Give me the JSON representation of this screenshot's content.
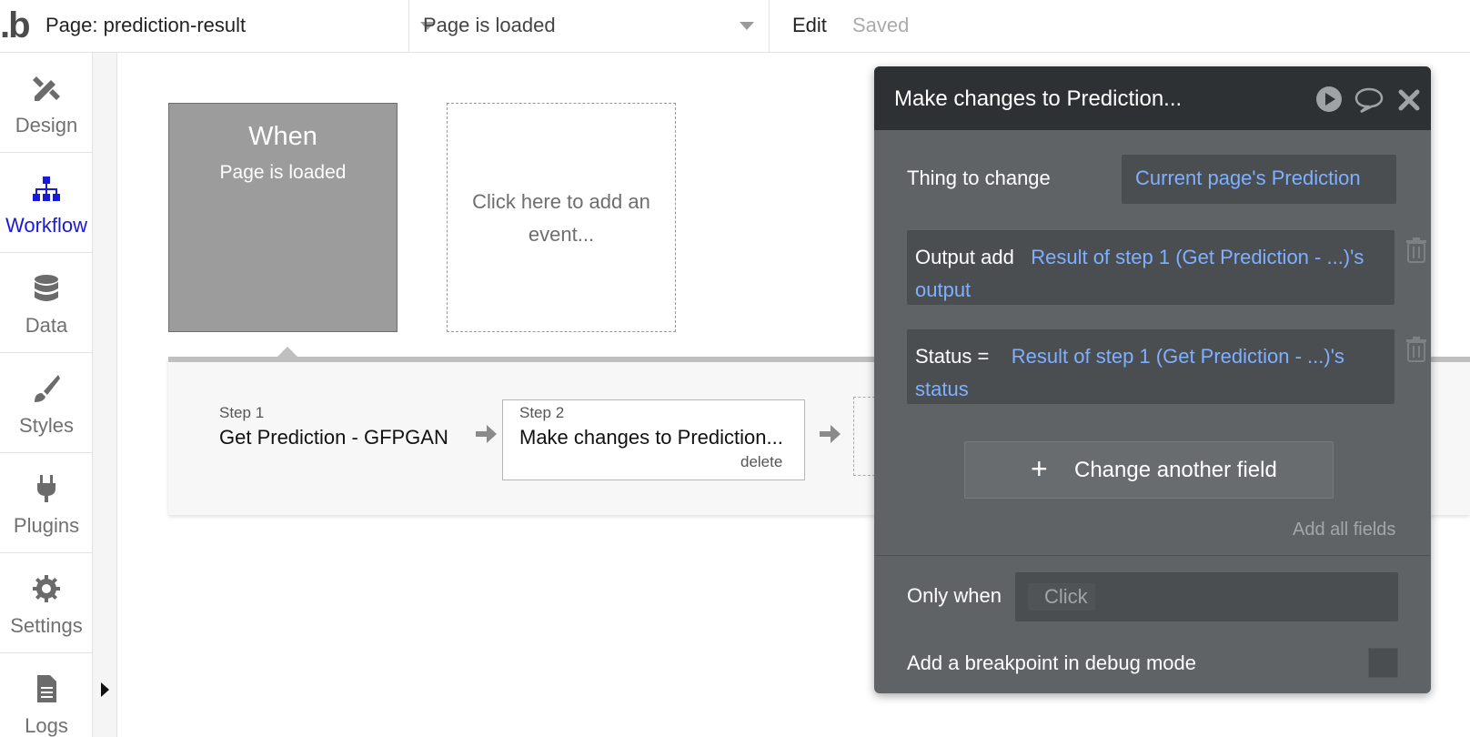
{
  "topbar": {
    "logo": ".b",
    "page_select": "Page: prediction-result",
    "event_select": "Page is loaded",
    "edit": "Edit",
    "status": "Saved"
  },
  "sidebar": {
    "items": [
      {
        "label": "Design",
        "icon": "design-icon"
      },
      {
        "label": "Workflow",
        "icon": "workflow-icon"
      },
      {
        "label": "Data",
        "icon": "database-icon"
      },
      {
        "label": "Styles",
        "icon": "brush-icon"
      },
      {
        "label": "Plugins",
        "icon": "plug-icon"
      },
      {
        "label": "Settings",
        "icon": "gear-icon"
      },
      {
        "label": "Logs",
        "icon": "document-icon"
      }
    ],
    "active": "Workflow"
  },
  "canvas": {
    "event_card": {
      "when": "When",
      "trigger": "Page is loaded"
    },
    "add_event": "Click here to add an event...",
    "steps": [
      {
        "num": "Step 1",
        "title": "Get Prediction - GFPGAN"
      },
      {
        "num": "Step 2",
        "title": "Make changes to Prediction...",
        "delete": "delete"
      }
    ]
  },
  "panel": {
    "title": "Make changes to Prediction...",
    "thing_label": "Thing to change",
    "thing_value": "Current page's Prediction",
    "fields": [
      {
        "key": "Output add",
        "value": "Result of step 1 (Get Prediction - ...)'s output"
      },
      {
        "key": "Status  =",
        "value": "Result of step 1 (Get Prediction - ...)'s status"
      }
    ],
    "change_button": "Change another field",
    "add_all": "Add all fields",
    "only_when_label": "Only when",
    "only_when_placeholder": "Click",
    "breakpoint_label": "Add a breakpoint in debug mode"
  },
  "colors": {
    "link": "#7fb0ff",
    "active_nav": "#1a1ad6",
    "panel_bg": "#5f6366",
    "panel_header": "#2d3133"
  }
}
